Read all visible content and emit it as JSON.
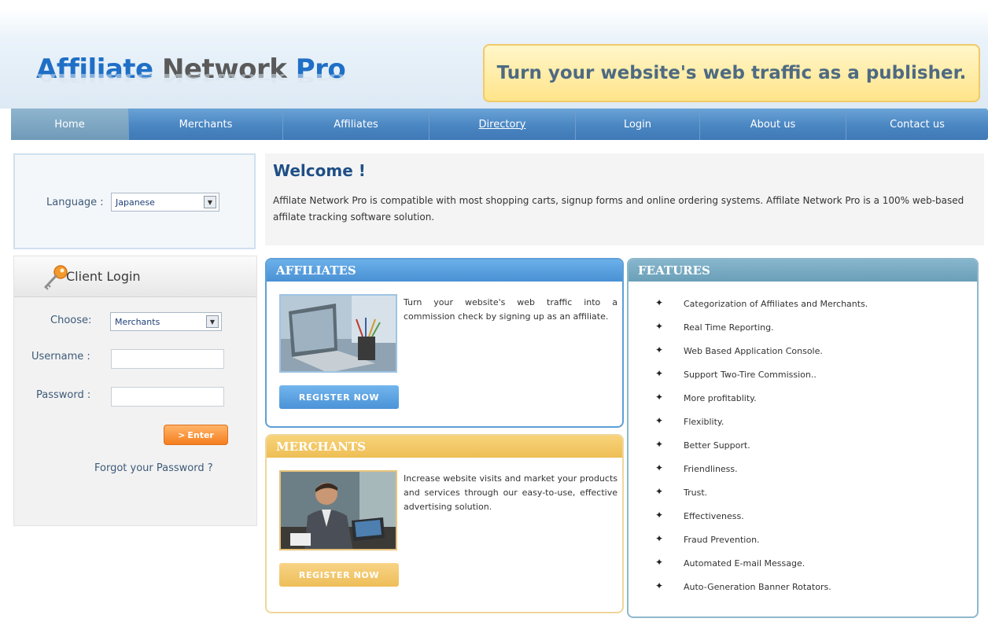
{
  "header": {
    "logo_part1": "Affiliate",
    "logo_part2": "Network",
    "logo_part3": "Pro",
    "tagline": "Turn your website's web traffic as a publisher."
  },
  "nav": {
    "items": [
      "Home",
      "Merchants",
      "Affiliates",
      "Directory",
      "Login",
      "About us",
      "Contact us"
    ],
    "active": "Home"
  },
  "language": {
    "label": "Language :",
    "selected": "Japanese"
  },
  "login": {
    "title": "Client Login",
    "choose_label": "Choose:",
    "choose_value": "Merchants",
    "username_label": "Username :",
    "username_value": "",
    "password_label": "Password :",
    "password_value": "",
    "enter_label": "Enter",
    "forgot_label": "Forgot your Password ?"
  },
  "welcome": {
    "title": "Welcome !",
    "text": "Affilate Network Pro is compatible with most shopping carts, signup forms and online ordering systems. Affilate Network Pro is a 100% web-based affilate tracking software solution."
  },
  "affiliates": {
    "title": "AFFILIATES",
    "text": "Turn your website's web traffic into a commission check by signing up as an affiliate.",
    "button": "REGISTER NOW"
  },
  "merchants": {
    "title": "MERCHANTS",
    "text": "Increase website visits and market your products and services through our easy-to-use, effective advertising solution.",
    "button": "REGISTER NOW"
  },
  "features": {
    "title": "FEATURES",
    "items": [
      "Categorization of Affiliates and Merchants.",
      "Real Time Reporting.",
      "Web Based Application Console.",
      "Support Two-Tire Commission..",
      "More profitablity.",
      "Flexiblity.",
      "Better Support.",
      "Friendliness.",
      "Trust.",
      "Effectiveness.",
      "Fraud Prevention.",
      "Automated E-mail Message.",
      "Auto-Generation Banner Rotators."
    ]
  },
  "colors": {
    "brand_blue": "#1f6fc6",
    "nav_blue": "#4a86c2",
    "affiliates_blue": "#4a91d4",
    "merchants_yellow": "#eebe55",
    "features_teal": "#6b9fb8",
    "enter_orange": "#f47e1e"
  }
}
